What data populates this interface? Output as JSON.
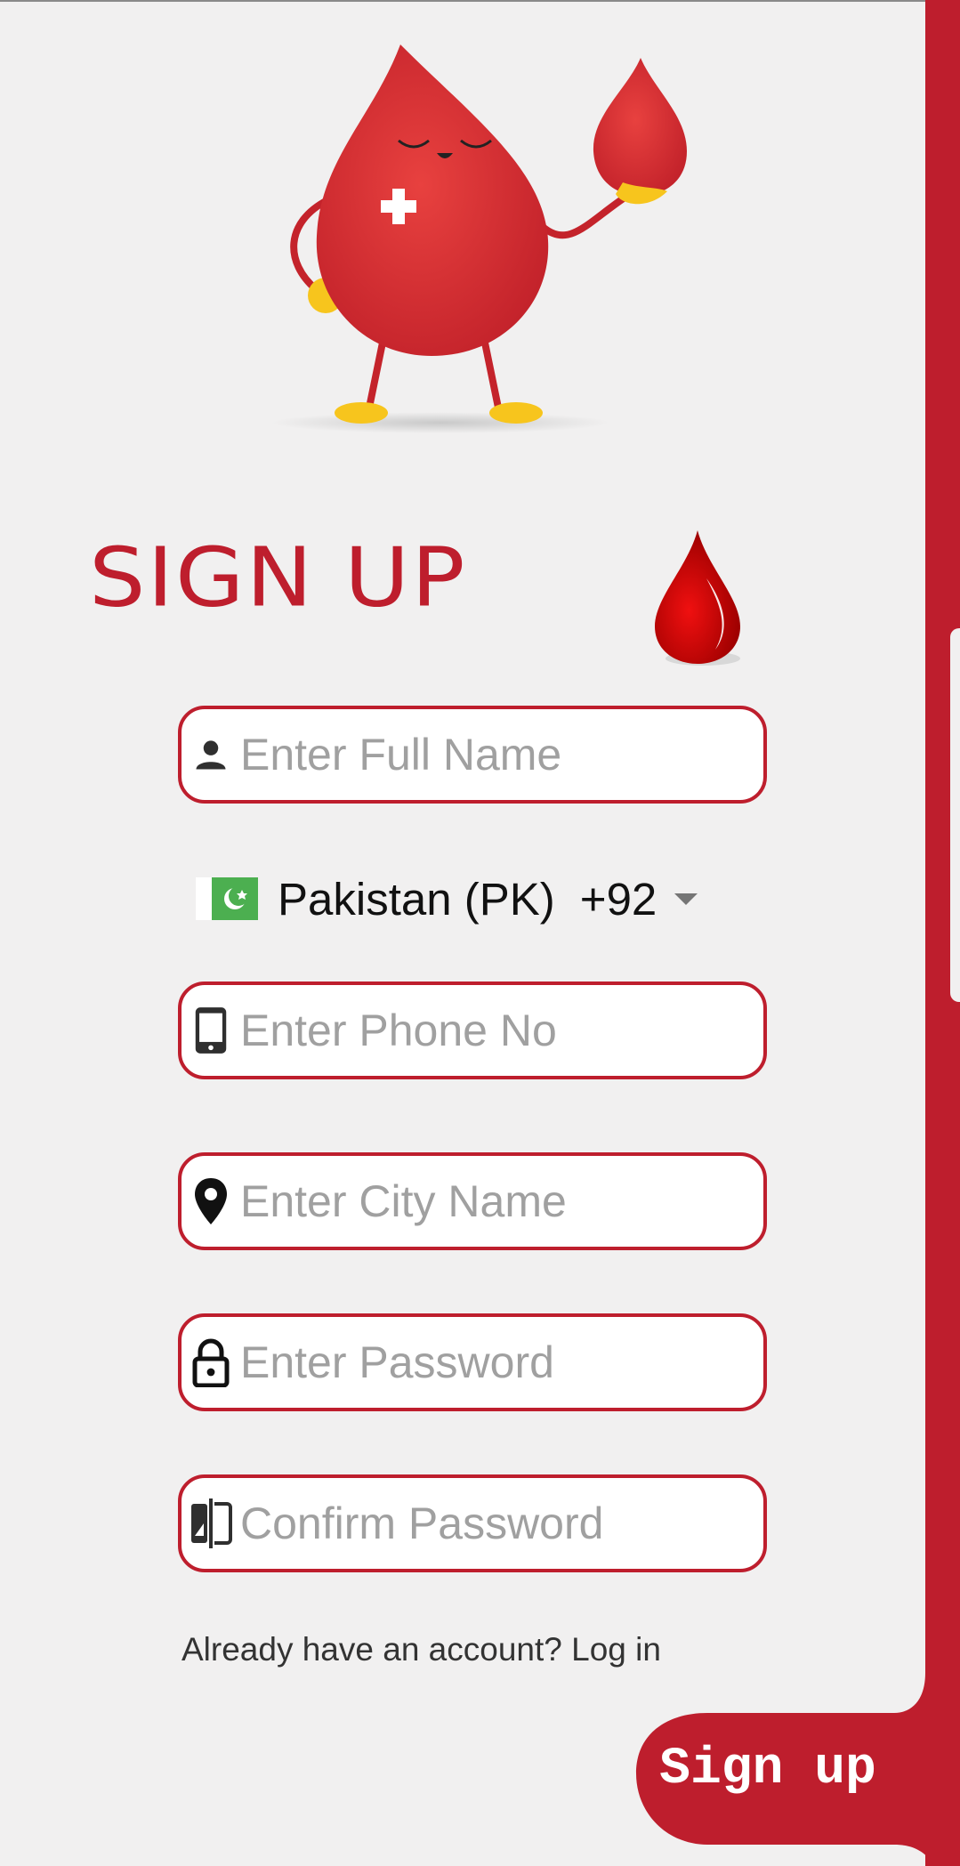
{
  "header": {
    "title": "SIGN UP"
  },
  "form": {
    "full_name": {
      "placeholder": "Enter Full Name",
      "value": ""
    },
    "country": {
      "name": "Pakistan (PK)",
      "dial_code": "+92",
      "flag_icon": "pakistan-flag-icon"
    },
    "phone": {
      "placeholder": "Enter Phone No",
      "value": ""
    },
    "city": {
      "placeholder": "Enter City Name",
      "value": ""
    },
    "password": {
      "placeholder": "Enter Password",
      "value": ""
    },
    "confirm_password": {
      "placeholder": "Confirm Password",
      "value": ""
    }
  },
  "footer": {
    "login_text": "Already have an account? Log in",
    "signup_label": "Sign up"
  },
  "icons": {
    "full_name": "person-icon",
    "phone": "smartphone-icon",
    "city": "location-pin-icon",
    "password": "lock-icon",
    "confirm_password": "compare-icon"
  },
  "colors": {
    "accent": "#be1e2d",
    "background": "#f1f0f0",
    "placeholder": "#a0a0a0"
  }
}
